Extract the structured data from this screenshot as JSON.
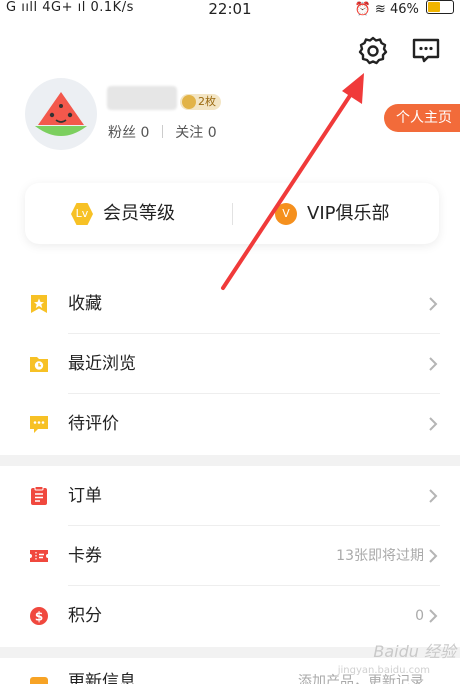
{
  "status_bar": {
    "left": "G ııll 4G+ ıl 0.1K/s",
    "time": "22:01",
    "battery": "46%"
  },
  "profile": {
    "medal": "2枚",
    "fans": "粉丝 0",
    "follow": "关注 0",
    "home_button": "个人主页"
  },
  "membership": {
    "level_badge": "Lv",
    "level_label": "会员等级",
    "vip_badge": "V",
    "vip_label": "VIP俱乐部"
  },
  "menu_group1": [
    {
      "label": "收藏",
      "icon": "star-bookmark-icon"
    },
    {
      "label": "最近浏览",
      "icon": "folder-clock-icon"
    },
    {
      "label": "待评价",
      "icon": "comment-icon"
    }
  ],
  "menu_group2": [
    {
      "label": "订单",
      "icon": "order-list-icon",
      "extra": ""
    },
    {
      "label": "卡券",
      "icon": "ticket-icon",
      "extra": "13张即将过期"
    },
    {
      "label": "积分",
      "icon": "points-coin-icon",
      "extra": "0"
    }
  ],
  "partial_row": {
    "label": "更新信息",
    "extra": "添加产品，更新记录"
  },
  "watermark": {
    "brand": "Baidu 经验",
    "url": "jingyan.baidu.com"
  },
  "colors": {
    "accent_orange": "#f26b3a",
    "annotation_red": "#f03a3a",
    "icon_yellow": "#f7c125",
    "icon_red": "#f0483e"
  }
}
